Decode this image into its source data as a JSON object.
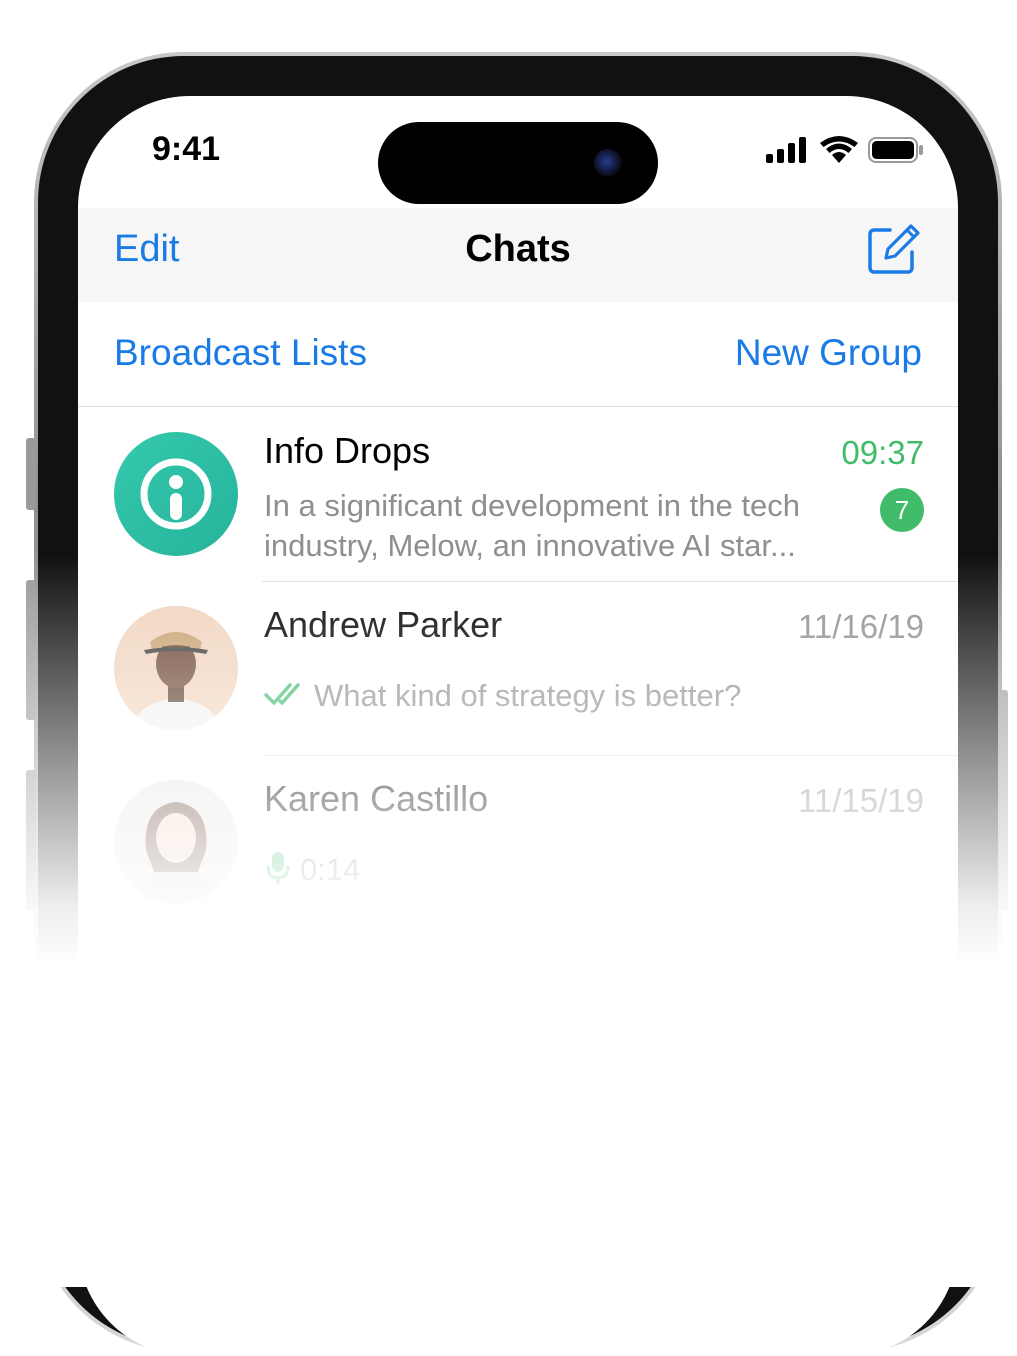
{
  "status_bar": {
    "time": "9:41",
    "icons": [
      "cellular-signal-icon",
      "wifi-icon",
      "battery-icon"
    ]
  },
  "navbar": {
    "edit_label": "Edit",
    "title": "Chats",
    "compose_icon": "compose-icon"
  },
  "actions": {
    "broadcast_label": "Broadcast Lists",
    "new_group_label": "New Group"
  },
  "chats": [
    {
      "name": "Info Drops",
      "time": "09:37",
      "preview": "In a significant development in the tech industry, Melow, an innovative AI star...",
      "unread": "7",
      "time_color": "#3fbb6a",
      "avatar_color": "#2fbfa9"
    },
    {
      "name": "Andrew Parker",
      "time": "11/16/19",
      "preview": "What kind of strategy is better?",
      "status_icon": "double-check-icon"
    },
    {
      "name": "Karen Castillo",
      "time": "11/15/19",
      "preview": "0:14",
      "status_icon": "microphone-icon"
    }
  ],
  "colors": {
    "accent": "#1a7ae6",
    "unread_green": "#3fbb6a",
    "secondary_text": "#8e8e93"
  }
}
